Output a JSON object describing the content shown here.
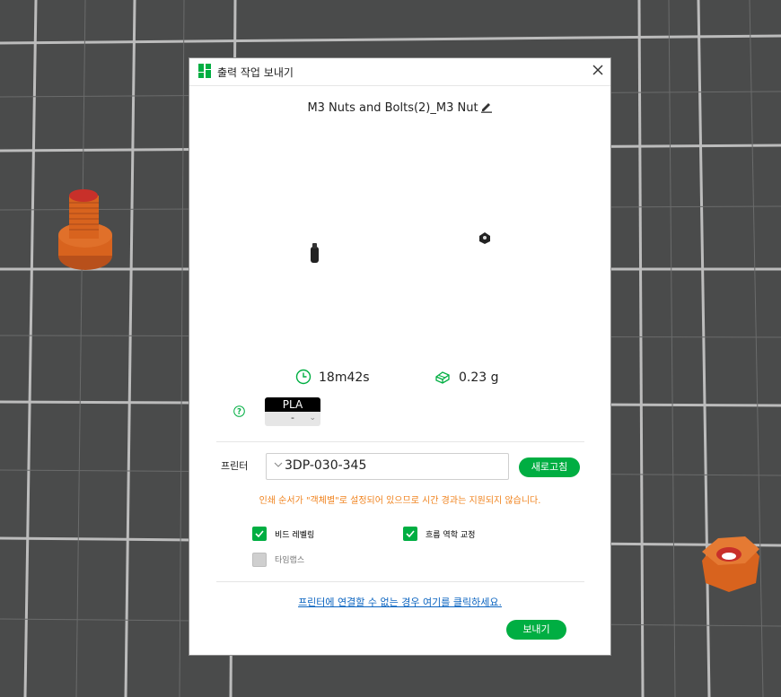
{
  "dialog": {
    "title": "출력 작업 보내기",
    "model_name": "M3 Nuts and Bolts(2)_M3 Nut",
    "stats": {
      "time": "18m42s",
      "weight": "0.23 g"
    },
    "filament": {
      "name": "PLA",
      "slot": "-"
    },
    "printer": {
      "label": "프린터",
      "selected": "3DP-030-345",
      "refresh_label": "새로고침"
    },
    "warning": "인쇄 순서가 \"객체별\"로 설정되어 있으므로 시간 경과는 지원되지 않습니다.",
    "options": [
      {
        "label": "비드 레벨링",
        "checked": true
      },
      {
        "label": "흐름 역학 교정",
        "checked": true
      },
      {
        "label": "타임랩스",
        "checked": false
      }
    ],
    "help_link": "프린터에 연결할 수 없는 경우 여기를 클릭하세요.",
    "send_label": "보내기"
  },
  "colors": {
    "accent": "#00ae42",
    "warning": "#f0831e",
    "link": "#0b64c0",
    "part": "#d8631e"
  }
}
